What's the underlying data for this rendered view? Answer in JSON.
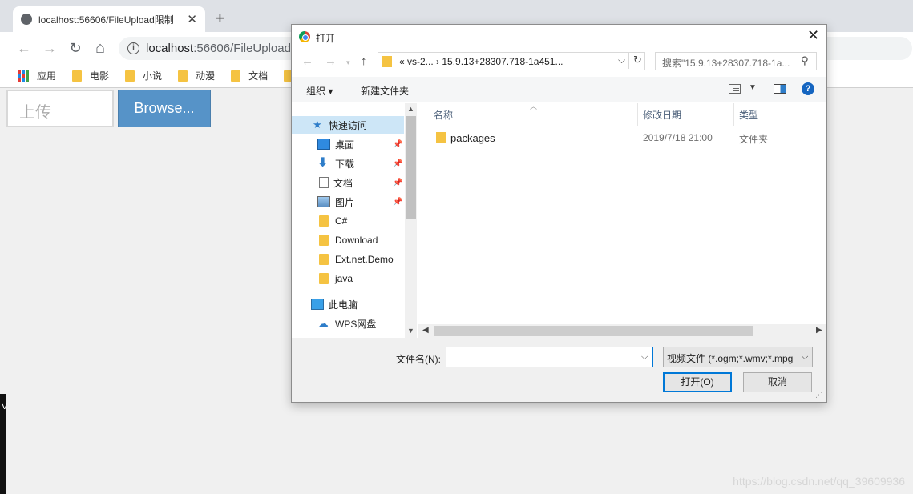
{
  "browser": {
    "tab_title": "localhost:56606/FileUpload限制",
    "tab_close": "✕",
    "new_tab": "+",
    "url_host": "localhost",
    "url_rest": ":56606/FileUpload",
    "back": "←",
    "forward": "→",
    "reload": "↻",
    "home": "⌂"
  },
  "bookmarks": [
    "应用",
    "电影",
    "小说",
    "动漫",
    "文档"
  ],
  "page": {
    "upload_placeholder": "上传",
    "browse_label": "Browse...",
    "left_strip_text": "V",
    "watermark": "https://blog.csdn.net/qq_39609936"
  },
  "dialog": {
    "title": "打开",
    "close": "✕",
    "address": {
      "crumbs": "«  vs-2...  ›  15.9.13+28307.718-1a451...",
      "dropdown": "⌵",
      "refresh": "↻"
    },
    "search_placeholder": "搜索\"15.9.13+28307.718-1a...",
    "toolbar": {
      "organize": "组织 ▾",
      "new_folder": "新建文件夹"
    },
    "nav_items": [
      {
        "label": "快速访问",
        "icon": "star-icon",
        "pinned": false
      },
      {
        "label": "桌面",
        "icon": "desktop-icon",
        "pinned": true
      },
      {
        "label": "下载",
        "icon": "download-icon",
        "pinned": true
      },
      {
        "label": "文档",
        "icon": "document-icon",
        "pinned": true
      },
      {
        "label": "图片",
        "icon": "picture-icon",
        "pinned": true
      },
      {
        "label": "C#",
        "icon": "folder-icon",
        "pinned": false
      },
      {
        "label": "Download",
        "icon": "folder-icon",
        "pinned": false
      },
      {
        "label": "Ext.net.Demo",
        "icon": "folder-icon",
        "pinned": false
      },
      {
        "label": "java",
        "icon": "folder-icon",
        "pinned": false
      },
      {
        "label": "此电脑",
        "icon": "computer-icon",
        "pinned": false
      },
      {
        "label": "WPS网盘",
        "icon": "cloud-icon",
        "pinned": false
      }
    ],
    "columns": {
      "name": "名称",
      "modified": "修改日期",
      "type": "类型"
    },
    "files": [
      {
        "name": "packages",
        "modified": "2019/7/18 21:00",
        "type": "文件夹"
      }
    ],
    "filename_label": "文件名(N):",
    "filename_value": "",
    "filter": "视频文件 (*.ogm;*.wmv;*.mpg",
    "open_button": "打开(O)",
    "cancel_button": "取消"
  }
}
